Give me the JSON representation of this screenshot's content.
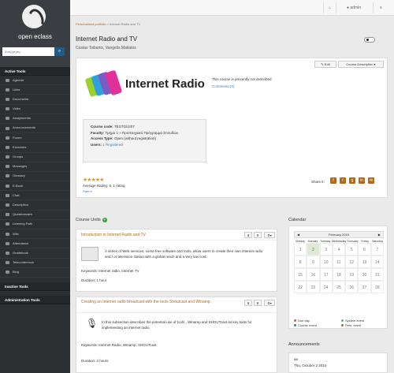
{
  "sidebar": {
    "brand": "open eclass",
    "search_placeholder": "Αναζήτηση...",
    "active_tools": "Active Tools",
    "items": [
      "Agenda",
      "Links",
      "Documents",
      "Video",
      "Assignments",
      "Announcements",
      "Forum",
      "Exercises",
      "Groups",
      "Messages",
      "Glossary",
      "E-Book",
      "Chat",
      "Description",
      "Questionnaire",
      "Learning Path",
      "Wiki",
      "Attendance",
      "Gradebook",
      "Teleconference",
      "Blog"
    ],
    "inactive_tools": "Inactive Tools",
    "admin_tools": "Administration Tools"
  },
  "topbar": {
    "user": "admin"
  },
  "breadcrumb": {
    "portfolio": "Personalised portfolio",
    "sep": ">",
    "current": "Internet Radio and TV"
  },
  "course": {
    "title": "Internet Radio and TV",
    "professors": "Costas Tsibanis, Vangelis Matiatos",
    "edit_label": "Edit",
    "desc_btn": "Course Description",
    "logo_text": "Internet Radio",
    "no_desc": "This course is presently not described",
    "comments": "Comments (0)",
    "code_label": "Course code:",
    "code": "TESTGU207",
    "faculty_label": "Faculty:",
    "faculty": "Τμήμα 1 » Προπτυχιακό Πρόγραμμα Σπουδών",
    "access_label": "Access Type:",
    "access": "Open (without registration)",
    "users_label": "Users:",
    "users": "1 Registered",
    "stars": "★★★★★",
    "rating": "Average Rating: 5, 1 rating",
    "rate_link": "Rate it",
    "share": "Share it:"
  },
  "units": {
    "heading": "Course Units",
    "u1": {
      "title": "Introduction to Internet Radio and TV",
      "text": "A series of Web services, some free software and tools, allow users to create their own internet radio and / or television station with a global reach and a very low cost.",
      "keywords": "Keywords: Internet radio, Internet TV",
      "duration": "Duration: 1 hour"
    },
    "u2": {
      "title": "Creating an Internet radio broadcast with the tools Shoutcast and Winamp",
      "text": "In this subsection describes the potential use of tools , Winamp and SHOUTcast as key tools for implementing an internet radio.",
      "keywords": "Keywords: Internet Radio, Winamp, SHOUTcast.",
      "duration": "Duration: 2 hours"
    }
  },
  "calendar": {
    "heading": "Calendar",
    "month": "February 2015",
    "days": [
      "Sunday",
      "Monday",
      "Tuesday",
      "Wednesday",
      "Thursday",
      "Friday",
      "Saturday"
    ],
    "weeks": [
      [
        "1",
        "2",
        "3",
        "4",
        "5",
        "6",
        "7"
      ],
      [
        "8",
        "9",
        "10",
        "11",
        "12",
        "13",
        "14"
      ],
      [
        "15",
        "16",
        "17",
        "18",
        "19",
        "20",
        "21"
      ],
      [
        "22",
        "23",
        "24",
        "25",
        "26",
        "27",
        "28"
      ]
    ],
    "legend": {
      "due": "Due day",
      "system": "System event",
      "course": "Course event",
      "personal": "Pers. event"
    }
  },
  "announcements": {
    "heading": "Announcements",
    "item": "aa",
    "date": "Thu, October 2 2014"
  }
}
